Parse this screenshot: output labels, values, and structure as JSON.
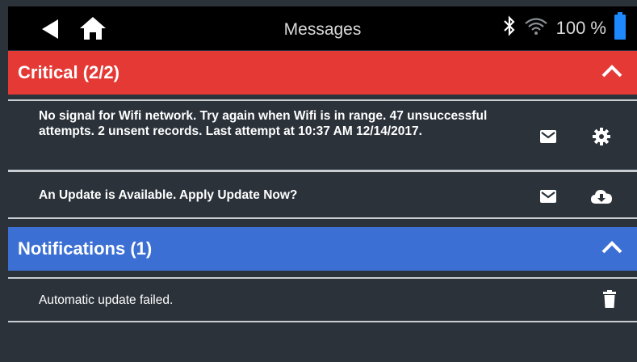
{
  "topbar": {
    "title": "Messages",
    "battery_text": "100 %",
    "icons": [
      "back-arrow-icon",
      "home-icon",
      "bluetooth-icon",
      "wifi-icon",
      "battery-icon"
    ]
  },
  "sections": {
    "critical": {
      "label": "Critical (2/2)",
      "color": "#e53935",
      "icon": "chevron-up-icon"
    },
    "notifications": {
      "label": "Notifications (1)",
      "color": "#3b6fd3",
      "icon": "chevron-up-icon"
    }
  },
  "messages": {
    "wifi": {
      "text": "No signal for Wifi network. Try again when Wifi is in range. 47 unsuccessful attempts. 2 unsent records. Last attempt at 10:37 AM 12/14/2017.",
      "icons": [
        "envelope-icon",
        "gear-icon"
      ]
    },
    "update": {
      "text": "An Update is Available. Apply Update Now?",
      "icons": [
        "envelope-icon",
        "cloud-download-icon"
      ]
    },
    "failed": {
      "text": "Automatic update failed.",
      "icons": [
        "trash-icon"
      ]
    }
  },
  "colors": {
    "background": "#2b323a",
    "topbar": "#000000",
    "battery": "#1e88ff"
  }
}
